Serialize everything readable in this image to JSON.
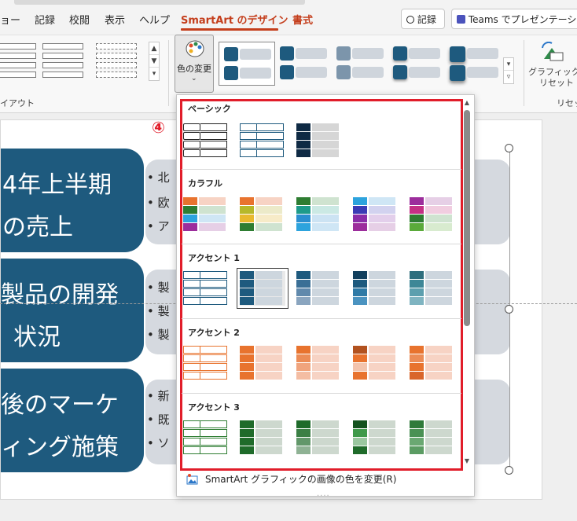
{
  "tabs": {
    "items": [
      "ョー",
      "記録",
      "校閲",
      "表示",
      "ヘルプ",
      "SmartArt のデザイン",
      "書式"
    ],
    "record_button": "記録",
    "teams_button": "Teams でプレゼンテーショ"
  },
  "ribbon": {
    "layout_group_label": "イアウト",
    "color_change_label": "色の変更",
    "reset_label_1": "グラフィックの",
    "reset_label_2": "リセット",
    "reset_group_label": "リセッ"
  },
  "annotation": {
    "step": "④"
  },
  "slide": {
    "rows": [
      {
        "title": [
          "4年上半期",
          "の売上"
        ],
        "bullets": [
          "北",
          "欧",
          "ア"
        ]
      },
      {
        "title": [
          "製品の開発",
          "状況"
        ],
        "bullets": [
          "製",
          "製",
          "製"
        ]
      },
      {
        "title": [
          "後のマーケ",
          "ィング施策"
        ],
        "bullets": [
          "新",
          "既",
          "ソ"
        ]
      }
    ]
  },
  "panel": {
    "sections": [
      {
        "title": "ベーシック"
      },
      {
        "title": "カラフル"
      },
      {
        "title": "アクセント 1"
      },
      {
        "title": "アクセント 2"
      },
      {
        "title": "アクセント 3"
      }
    ],
    "footer": "SmartArt グラフィックの画像の色を変更(R)"
  },
  "colors": {
    "navy": "#1e5a7e",
    "highlight_red": "#e11d2a",
    "accent_tab": "#c43e1c"
  }
}
